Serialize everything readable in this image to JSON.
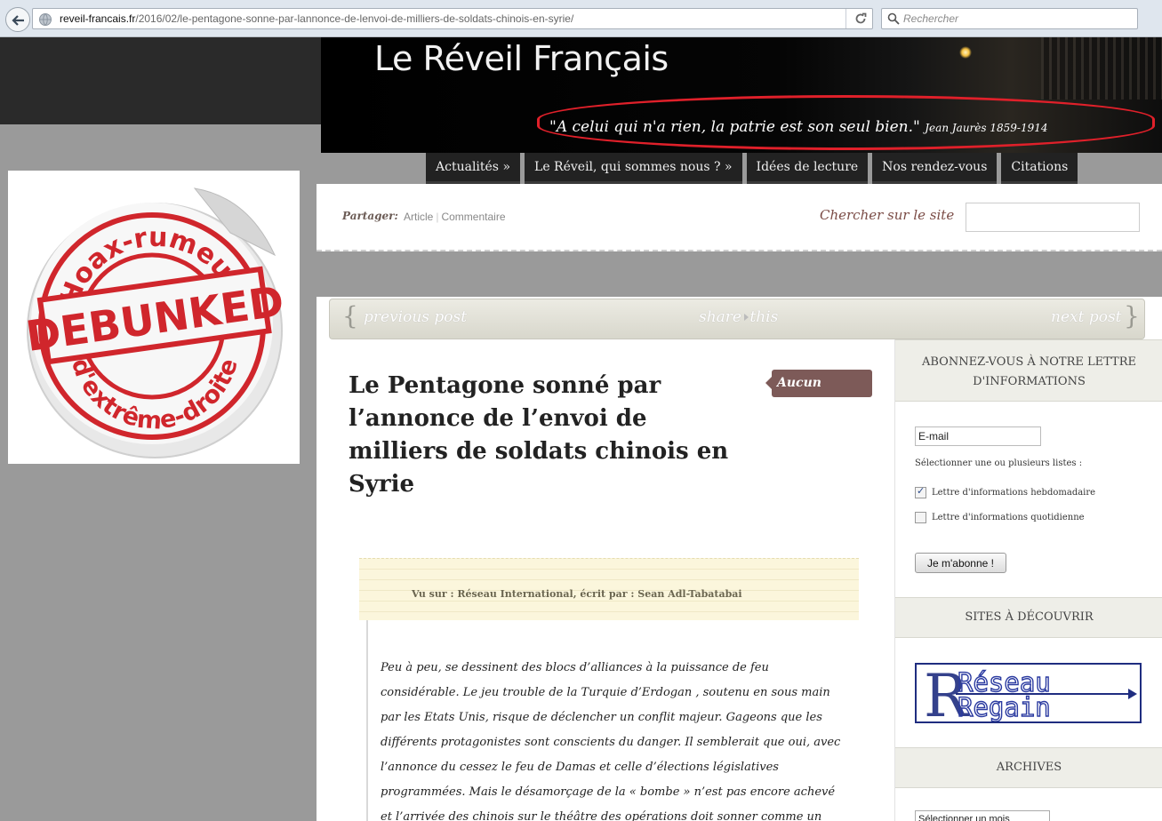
{
  "browser": {
    "url_domain": "reveil-francais.fr",
    "url_path": "/2016/02/le-pentagone-sonne-par-lannonce-de-lenvoi-de-milliers-de-soldats-chinois-en-syrie/",
    "search_placeholder": "Rechercher"
  },
  "header": {
    "site_title": "Le Réveil Français",
    "quote": "\"A celui qui n'a rien, la patrie est son seul bien.\"",
    "quote_author": "Jean Jaurès 1859-1914"
  },
  "nav": {
    "items": [
      {
        "label": "Actualités »"
      },
      {
        "label": "Le Réveil, qui sommes nous ? »"
      },
      {
        "label": "Idées de lecture"
      },
      {
        "label": "Nos rendez-vous"
      },
      {
        "label": "Citations"
      }
    ]
  },
  "overlay_image": {
    "top_text": "Hoax-rumeurs",
    "stamp_text": "DEBUNKED",
    "bottom_text": "d'extrême-droite"
  },
  "sharebar": {
    "label": "Partager:",
    "link_article": "Article",
    "link_comment": "Commentaire",
    "search_label": "Chercher sur le site"
  },
  "postnav": {
    "previous": "previous post",
    "share": "share",
    "this": "this",
    "next": "next post"
  },
  "post": {
    "title": "Le Pentagone sonné par l’annonce de l’envoi de milliers de soldats chinois en Syrie",
    "category_tag": "Aucun",
    "source_note": "Vu sur : Réseau International, écrit par : Sean Adl-Tabatabai",
    "body": "Peu à peu, se dessinent des blocs d’alliances à la puissance de feu considérable. Le jeu trouble de la Turquie d’Erdogan , soutenu en sous main par les Etats Unis, risque de déclencher un conflit majeur. Gageons que les différents protagonistes sont conscients du danger. Il semblerait que oui, avec l’annonce du cessez le feu de Damas et celle d’élections législatives programmées. Mais le désamorçage de la « bombe » n’est pas encore achevé et l’arrivée des chinois sur le théâtre des opérations doit sonner comme un avertissement."
  },
  "sidebar": {
    "newsletter_title": "ABONNEZ-VOUS À NOTRE LETTRE D'INFORMATIONS",
    "email_value": "E-mail",
    "select_lists_label": "Sélectionner une ou plusieurs listes :",
    "list_weekly": "Lettre d'informations hebdomadaire",
    "list_daily": "Lettre d'informations quotidienne",
    "weekly_checked": true,
    "daily_checked": false,
    "subscribe_button": "Je m'abonne !",
    "sites_title": "SITES À DÉCOUVRIR",
    "partner_logo_line1": "Réseau",
    "partner_logo_line2": "Regain",
    "archives_title": "ARCHIVES",
    "archives_select": "Sélectionner un mois"
  },
  "colors": {
    "accent_red": "#e0202a",
    "tag_brown": "#7d5a58",
    "nav_bg": "#222222",
    "regain_blue": "#1f2d80"
  }
}
